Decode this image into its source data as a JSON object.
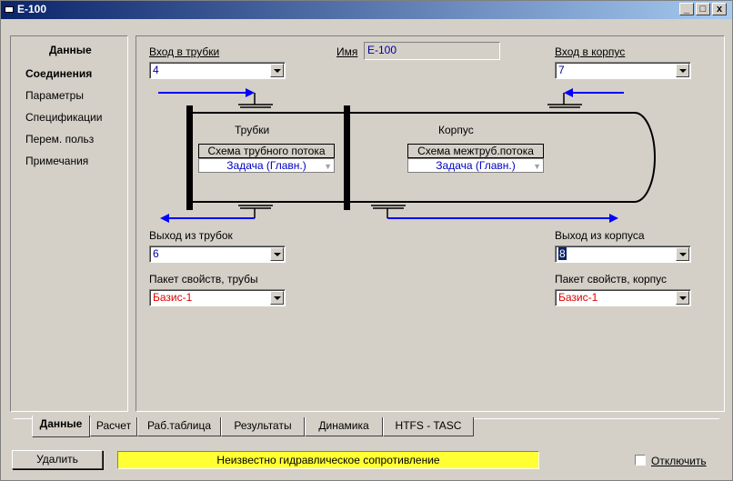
{
  "window": {
    "title": "E-100",
    "btn_minimize": "_",
    "btn_maximize": "□",
    "btn_close": "x"
  },
  "sidebar": {
    "header": "Данные",
    "items": [
      {
        "label": "Соединения"
      },
      {
        "label": "Параметры"
      },
      {
        "label": "Спецификации"
      },
      {
        "label": "Перем. польз"
      },
      {
        "label": "Примечания"
      }
    ]
  },
  "form": {
    "tube_inlet_label": "Вход в трубки",
    "tube_inlet_value": "4",
    "name_label": "Имя",
    "name_value": "E-100",
    "shell_inlet_label": "Вход в корпус",
    "shell_inlet_value": "7",
    "tube_outlet_label": "Выход из трубок",
    "tube_outlet_value": "6",
    "shell_outlet_label": "Выход из корпуса",
    "shell_outlet_value": "8",
    "tube_fluid_pkg_label": "Пакет свойств, трубы",
    "tube_fluid_pkg_value": "Базис-1",
    "shell_fluid_pkg_label": "Пакет свойств, корпус",
    "shell_fluid_pkg_value": "Базис-1"
  },
  "diagram": {
    "tube_side_label": "Трубки",
    "shell_side_label": "Корпус",
    "tube_flow_title": "Схема трубного потока",
    "tube_flow_value": "Задача (Главн.)",
    "shell_flow_title": "Схема межтруб.потока",
    "shell_flow_value": "Задача (Главн.)",
    "colors": {
      "arrow": "#0000ff",
      "shell": "#000000"
    }
  },
  "tabs": [
    {
      "label": "Данные",
      "active": true
    },
    {
      "label": "Расчет"
    },
    {
      "label": "Раб.таблица"
    },
    {
      "label": "Результаты"
    },
    {
      "label": "Динамика"
    },
    {
      "label": "HTFS - TASC"
    }
  ],
  "footer": {
    "delete_label": "Удалить",
    "status_text": "Неизвестно гидравлическое сопротивление",
    "status_color": "#ffff33",
    "ignore_label": "Отключить"
  }
}
